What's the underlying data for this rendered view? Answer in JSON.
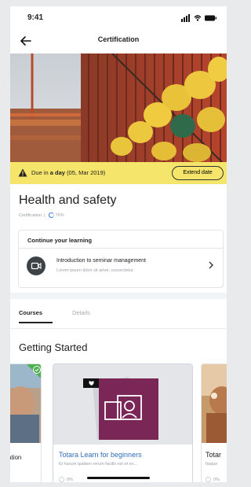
{
  "status_bar": {
    "time": "9:41"
  },
  "header": {
    "title": "Certification",
    "back_icon": "back-arrow-icon"
  },
  "alert": {
    "prefix": "Due in",
    "bold": "a day",
    "date": "(05, Mar 2019)",
    "button_label": "Extend date",
    "color": "#f5e56a"
  },
  "course": {
    "title": "Health and safety",
    "type": "Certification",
    "progress_text": "76%",
    "progress": 0.76
  },
  "continue_learning": {
    "heading": "Continue your learning",
    "item": {
      "title": "Introduction to seminar management",
      "subtitle": "Lorem ipsum dolor sit amet, consectetur",
      "icon": "video-icon"
    }
  },
  "tabs": [
    {
      "label": "Courses",
      "active": true
    },
    {
      "label": "Details",
      "active": false
    }
  ],
  "section_title": "Getting Started",
  "cards": [
    {
      "title": "ation",
      "progress_text": "",
      "completed": true
    },
    {
      "title": "Totara Learn for beginners",
      "description": "Et harum quidem rerum facilis est et ex...",
      "progress_text": "0%"
    },
    {
      "title": "Totar",
      "description": "Itaque",
      "progress_text": "0%"
    }
  ],
  "colors": {
    "accent_blue": "#2f6eb7",
    "completed_green": "#4caf50",
    "purple": "#7a2656"
  }
}
